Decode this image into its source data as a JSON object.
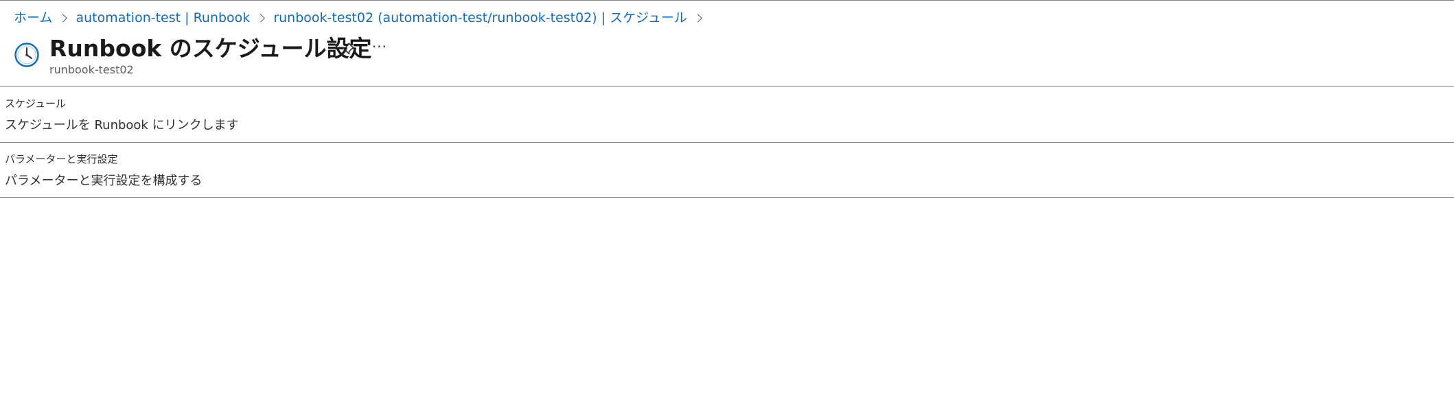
{
  "breadcrumb": {
    "items": [
      {
        "label": "ホーム"
      },
      {
        "label": "automation-test | Runbook"
      },
      {
        "label": "runbook-test02 (automation-test/runbook-test02) | スケジュール"
      }
    ]
  },
  "header": {
    "title": "Runbook のスケジュール設定",
    "subtitle": "runbook-test02",
    "more_label": "···"
  },
  "sections": [
    {
      "label": "スケジュール",
      "value": "スケジュールを Runbook にリンクします"
    },
    {
      "label": "パラメーターと実行設定",
      "value": "パラメーターと実行設定を構成する"
    }
  ],
  "colors": {
    "link": "#0f6cbd",
    "icon_accent": "#0f6cbd",
    "divider": "#8a8886",
    "text": "#323130"
  },
  "icons": {
    "page": "clock-icon",
    "pin": "pin-icon",
    "more": "more-icon",
    "separator": "chevron-right-icon"
  }
}
